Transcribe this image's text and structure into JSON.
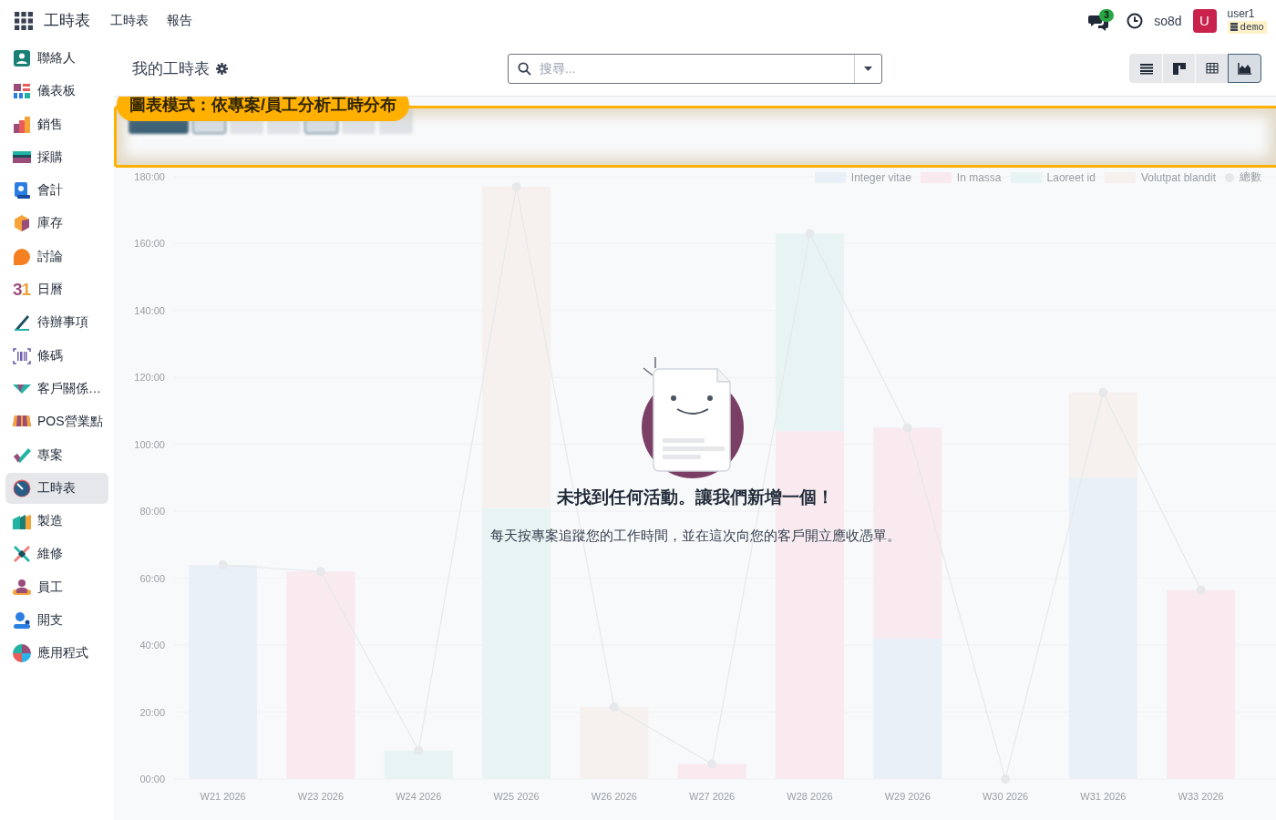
{
  "navbar": {
    "app_name": "工時表",
    "menu": [
      "工時表",
      "報告"
    ],
    "messages_count": "3",
    "company": "so8d",
    "avatar_letter": "U",
    "user": "user1",
    "database": "demo"
  },
  "sidebar": {
    "items": [
      {
        "label": "聯絡人",
        "selected": false
      },
      {
        "label": "儀表板",
        "selected": false
      },
      {
        "label": "銷售",
        "selected": false
      },
      {
        "label": "採購",
        "selected": false
      },
      {
        "label": "會計",
        "selected": false
      },
      {
        "label": "庫存",
        "selected": false
      },
      {
        "label": "討論",
        "selected": false
      },
      {
        "label": "日曆",
        "selected": false,
        "glyph": "31"
      },
      {
        "label": "待辦事項",
        "selected": false
      },
      {
        "label": "條碼",
        "selected": false
      },
      {
        "label": "客戶關係…",
        "selected": false
      },
      {
        "label": "POS營業點",
        "selected": false
      },
      {
        "label": "專案",
        "selected": false
      },
      {
        "label": "工時表",
        "selected": true
      },
      {
        "label": "製造",
        "selected": false
      },
      {
        "label": "維修",
        "selected": false
      },
      {
        "label": "員工",
        "selected": false
      },
      {
        "label": "開支",
        "selected": false
      },
      {
        "label": "應用程式",
        "selected": false
      }
    ]
  },
  "control_panel": {
    "title": "我的工時表",
    "search": {
      "placeholder": "搜尋..."
    },
    "views": [
      {
        "kind": "list",
        "selected": false
      },
      {
        "kind": "kanban",
        "selected": false
      },
      {
        "kind": "pivot",
        "selected": false
      },
      {
        "kind": "graph",
        "selected": true
      }
    ]
  },
  "callout": {
    "label": "圖表模式：依專案/員工分析工時分布"
  },
  "empty_state": {
    "title": "未找到任何活動。讓我們新增一個！",
    "text": "每天按專案追蹤您的工作時間，並在這次向您的客戶開立應收憑單。"
  },
  "chart_data": {
    "type": "bar",
    "stacked": true,
    "categories": [
      "W21 2026",
      "W23 2026",
      "W24 2026",
      "W25 2026",
      "W26 2026",
      "W27 2026",
      "W28 2026",
      "W29 2026",
      "W30 2026",
      "W31 2026",
      "W33 2026"
    ],
    "ylim": [
      0,
      180
    ],
    "grid": true,
    "legend": true,
    "yticks": [
      {
        "value": 0,
        "label": "00:00"
      },
      {
        "value": 20,
        "label": "20:00"
      },
      {
        "value": 40,
        "label": "40:00"
      },
      {
        "value": 60,
        "label": "60:00"
      },
      {
        "value": 80,
        "label": "80:00"
      },
      {
        "value": 100,
        "label": "100:00"
      },
      {
        "value": 120,
        "label": "120:00"
      },
      {
        "value": 140,
        "label": "140:00"
      },
      {
        "value": 160,
        "label": "160:00"
      },
      {
        "value": 180,
        "label": "180:00"
      }
    ],
    "series": [
      {
        "name": "Integer vitae",
        "color": "#e9f0f8",
        "values": [
          64,
          0,
          0,
          0,
          0,
          0,
          0,
          42,
          0,
          90,
          0
        ]
      },
      {
        "name": "In massa",
        "color": "#f8eaef",
        "values": [
          0,
          62,
          0,
          0,
          0,
          4.5,
          104,
          63,
          0,
          0,
          56.5
        ]
      },
      {
        "name": "Laoreet id",
        "color": "#e8f4f3",
        "values": [
          0,
          0,
          8.5,
          81,
          0,
          0,
          59,
          0,
          0,
          0,
          0
        ]
      },
      {
        "name": "Volutpat blandit",
        "color": "#f6f1ee",
        "values": [
          0,
          0,
          0,
          96,
          21.5,
          0,
          0,
          0,
          0,
          25.5,
          0
        ]
      },
      {
        "name": "總數",
        "color": "#e6e8eb",
        "type": "line",
        "marker": true,
        "values": [
          64,
          62,
          8.5,
          177,
          21.5,
          4.5,
          163,
          105,
          0,
          115.5,
          56.5
        ]
      }
    ]
  }
}
